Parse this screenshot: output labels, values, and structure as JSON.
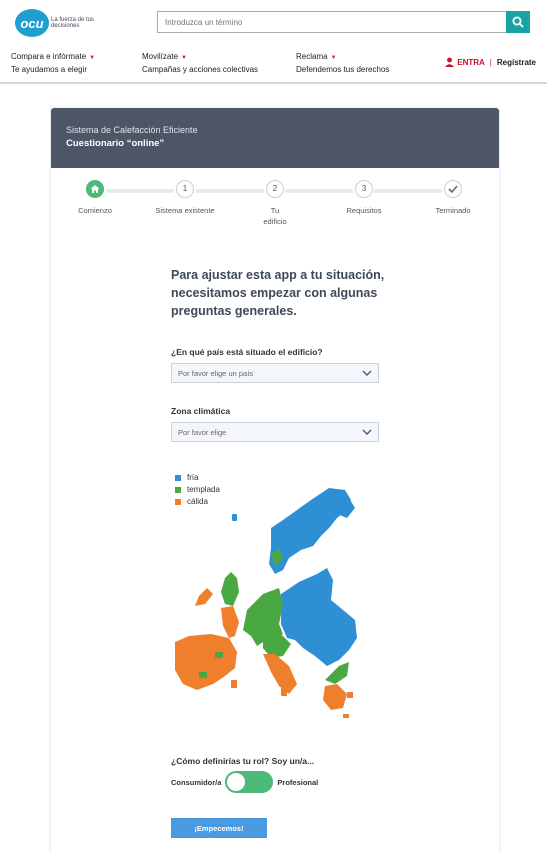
{
  "header": {
    "logo_text": "ocu",
    "logo_tagline": "La fuerza de tus decisiones",
    "search_placeholder": "Introduzca un término",
    "nav": [
      {
        "title": "Compara e infórmate",
        "subtitle": "Te ayudamos a elegir"
      },
      {
        "title": "Movilízate",
        "subtitle": "Campañas y acciones colectivas"
      },
      {
        "title": "Reclama",
        "subtitle": "Defendemos tus derechos"
      }
    ],
    "login_label": "ENTRA",
    "register_label": "Regístrate"
  },
  "card": {
    "subtitle": "Sistema de Calefacción Eficiente",
    "title": "Cuestionario “online”"
  },
  "steps": [
    {
      "label": "Comienzo",
      "marker": "home-icon",
      "active": true
    },
    {
      "label": "Sistema existente",
      "marker": "1"
    },
    {
      "label": "Tu edificio",
      "marker": "2"
    },
    {
      "label": "Requisitos",
      "marker": "3"
    },
    {
      "label": "Terminado",
      "marker": "check-icon"
    }
  ],
  "intro": "Para ajustar esta app a tu situación, necesitamos empezar con algunas preguntas generales.",
  "country_question": "¿En qué país está situado el edificio?",
  "country_placeholder": "Por favor elige un país",
  "climate_question": "Zona climática",
  "climate_placeholder": "Por favor elige",
  "legend": [
    {
      "label": "fría",
      "color": "#2e8fd4"
    },
    {
      "label": "templada",
      "color": "#4aa843"
    },
    {
      "label": "cálida",
      "color": "#f07f2d"
    }
  ],
  "role_question": "¿Cómo definirías tu rol? Soy un/a...",
  "role_left": "Consumidor/a",
  "role_right": "Profesional",
  "start_button": "¡Empecemos!",
  "colors": {
    "accent": "#1aa3a3",
    "header_card": "#4c5667",
    "green": "#4cb87a",
    "button": "#4a9ae2"
  }
}
